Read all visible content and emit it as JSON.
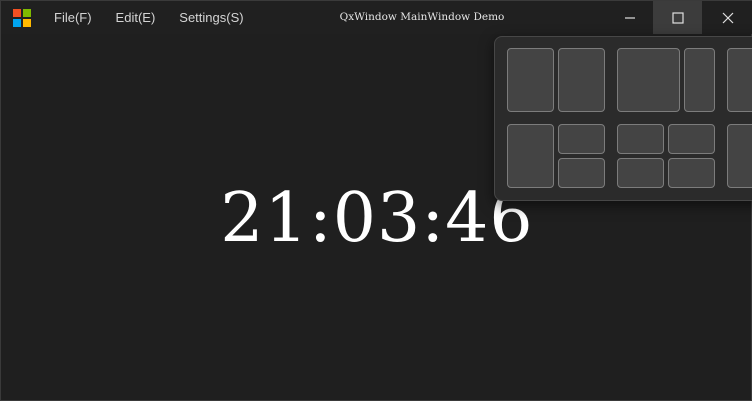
{
  "window": {
    "title": "QxWindow MainWindow Demo",
    "logo_colors": [
      "#f25022",
      "#7fba00",
      "#00a4ef",
      "#ffb900"
    ]
  },
  "menu": {
    "items": [
      {
        "label": "File(F)"
      },
      {
        "label": "Edit(E)"
      },
      {
        "label": "Settings(S)"
      }
    ]
  },
  "controls": {
    "minimize_icon": "minimize-icon",
    "maximize_icon": "maximize-icon",
    "close_icon": "close-icon"
  },
  "clock": {
    "time": "21:03:46"
  },
  "snap_layouts": {
    "layouts": [
      {
        "name": "two-equal-columns",
        "zones": 2
      },
      {
        "name": "wide-left-narrow-right",
        "zones": 2
      },
      {
        "name": "partial-third-layout-top",
        "zones": 1
      },
      {
        "name": "left-column-right-stacked",
        "zones": 3
      },
      {
        "name": "four-quadrants",
        "zones": 4
      },
      {
        "name": "partial-third-layout-bottom",
        "zones": 1
      }
    ]
  },
  "colors": {
    "background": "#1f1f1f",
    "titlebar": "#202020",
    "maximize_hover": "#3c3c3c",
    "flyout": "#2b2b2b",
    "zone": "#444444"
  }
}
